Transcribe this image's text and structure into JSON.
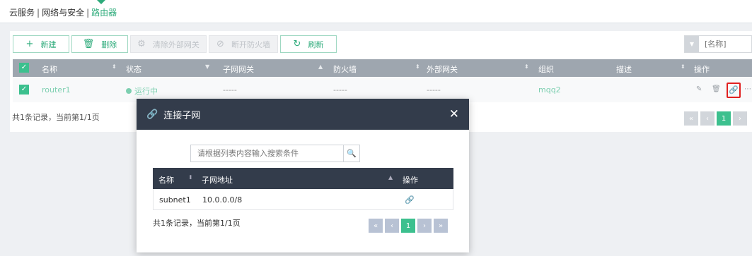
{
  "breadcrumb": {
    "items": [
      "云服务",
      "网络与安全"
    ],
    "current": "路由器",
    "separator": "|"
  },
  "toolbar": {
    "new": {
      "label": "新建",
      "icon": "plus-icon"
    },
    "delete": {
      "label": "删除",
      "icon": "trash-icon"
    },
    "clear_gateway": {
      "label": "清除外部网关",
      "icon": "gear-icon"
    },
    "disconnect_firewall": {
      "label": "断开防火墙",
      "icon": "unlink-icon"
    },
    "refresh": {
      "label": "刷新",
      "icon": "refresh-icon"
    }
  },
  "search": {
    "placeholder": "[名称]"
  },
  "table": {
    "headers": [
      "名称",
      "状态",
      "子网网关",
      "防火墙",
      "外部网关",
      "组织",
      "描述",
      "操作"
    ],
    "rows": [
      {
        "name": "router1",
        "status": "运行中",
        "subnet_gateway": "-----",
        "firewall": "-----",
        "external_gateway": "-----",
        "org": "mqq2",
        "description": ""
      }
    ]
  },
  "footer": {
    "summary": "共1条记录，当前第1/1页",
    "page": "1"
  },
  "modal": {
    "title": "连接子网",
    "close": "✕",
    "search_placeholder": "请根据列表内容输入搜索条件",
    "headers": [
      "名称",
      "子网地址",
      "操作"
    ],
    "rows": [
      {
        "name": "subnet1",
        "cidr": "10.0.0.0/8"
      }
    ],
    "summary": "共1条记录，当前第1/1页",
    "page": "1"
  },
  "colors": {
    "accent": "#2eab7b",
    "header_dark": "#333c4b",
    "table_header": "#9ea6af",
    "highlight": "#e02020"
  }
}
